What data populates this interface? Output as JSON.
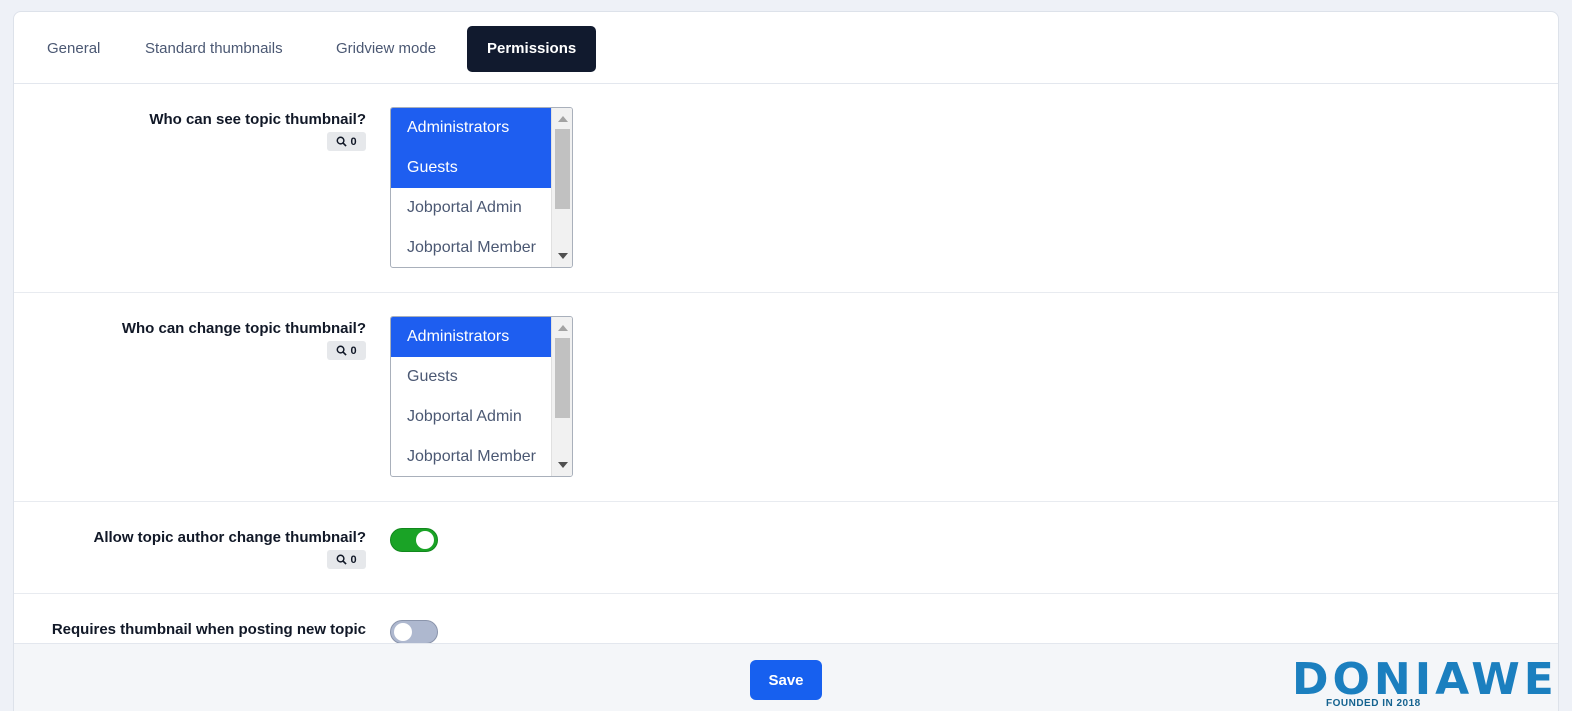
{
  "tabs": [
    {
      "label": "General",
      "active": false
    },
    {
      "label": "Standard thumbnails",
      "active": false
    },
    {
      "label": "Gridview mode",
      "active": false
    },
    {
      "label": "Permissions",
      "active": true
    }
  ],
  "settings": {
    "see_thumbnail": {
      "label": "Who can see topic thumbnail?",
      "badge_count": "0",
      "options": [
        {
          "label": "Administrators",
          "selected": true
        },
        {
          "label": "Guests",
          "selected": true
        },
        {
          "label": "Jobportal Admin",
          "selected": false
        },
        {
          "label": "Jobportal Member",
          "selected": false
        }
      ]
    },
    "change_thumbnail": {
      "label": "Who can change topic thumbnail?",
      "badge_count": "0",
      "options": [
        {
          "label": "Administrators",
          "selected": true
        },
        {
          "label": "Guests",
          "selected": false
        },
        {
          "label": "Jobportal Admin",
          "selected": false
        },
        {
          "label": "Jobportal Member",
          "selected": false
        }
      ]
    },
    "author_change": {
      "label": "Allow topic author change thumbnail?",
      "badge_count": "0",
      "enabled": true
    },
    "require_thumbnail": {
      "label": "Requires thumbnail when posting new topic",
      "enabled": false
    }
  },
  "footer": {
    "save_label": "Save"
  },
  "logo": {
    "text": "DONIAWEB",
    "tagline": "FOUNDED IN 2018"
  },
  "colors": {
    "active_tab_bg": "#111a2e",
    "selected_option_bg": "#1e5ef0",
    "toggle_on": "#1aa326",
    "toggle_off": "#aeb8cf",
    "save_button": "#1760ef"
  }
}
